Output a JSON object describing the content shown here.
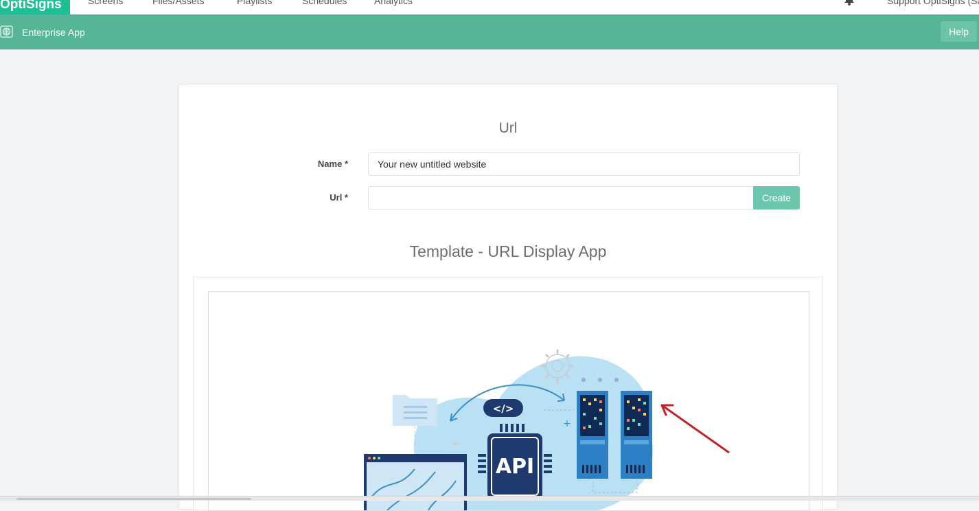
{
  "topnav": {
    "brand": "OptiSigns",
    "items": [
      "Screens",
      "Files/Assets",
      "Playlists",
      "Schedules",
      "Analytics"
    ],
    "user": "Support OptiSigns (Sa"
  },
  "appbar": {
    "title": "Enterprise App",
    "help_label": "Help"
  },
  "form": {
    "section_title": "Url",
    "name_label": "Name *",
    "name_value": "Your new untitled website",
    "url_label": "Url *",
    "url_value": "",
    "create_label": "Create"
  },
  "template": {
    "title": "Template - URL Display App",
    "code_tag": "</>",
    "api_label": "API"
  },
  "colors": {
    "brand": "#1fbf96",
    "appbar": "#56b596",
    "button": "#6cc7af",
    "arrow": "#c0232b"
  }
}
